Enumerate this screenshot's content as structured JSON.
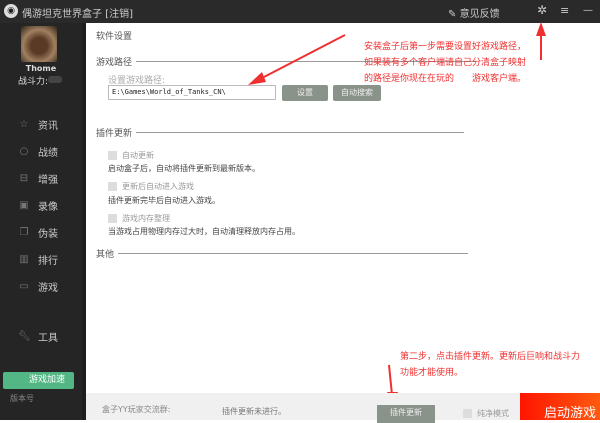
{
  "window": {
    "title": "偶游坦克世界盒子 [注销]",
    "feedback": "意见反馈"
  },
  "user": {
    "name": "Thome",
    "power_label": "战斗力:"
  },
  "sidebar": {
    "items": [
      {
        "label": "资讯",
        "icon": "star-icon"
      },
      {
        "label": "战绩",
        "icon": "search-icon"
      },
      {
        "label": "增强",
        "icon": "briefcase-icon"
      },
      {
        "label": "录像",
        "icon": "play-icon"
      },
      {
        "label": "伪装",
        "icon": "layers-icon"
      },
      {
        "label": "排行",
        "icon": "bar-chart-icon"
      },
      {
        "label": "游戏",
        "icon": "gamepad-icon"
      }
    ],
    "tools": "工具",
    "accelerate": "游戏加速",
    "version": "版本号"
  },
  "main": {
    "heading": "软件设置",
    "game_path": {
      "section": "游戏路径",
      "label": "设置游戏路径:",
      "value": "E:\\Games\\World_of_Tanks_CN\\",
      "set_button": "设置",
      "auto_button": "自动搜索"
    },
    "plugin": {
      "section": "插件更新",
      "options": [
        {
          "label": "自动更新",
          "desc": "启动盒子后，自动将插件更新到最新版本。",
          "checked": false
        },
        {
          "label": "更新后自动进入游戏",
          "desc": "插件更新完毕后自动进入游戏。",
          "checked": false
        },
        {
          "label": "游戏内存整理",
          "desc": "当游戏占用物理内存过大时，自动清理释放内存占用。",
          "checked": false
        }
      ]
    },
    "other": {
      "section": "其他"
    }
  },
  "annotations": {
    "note1_l1": "安装盒子后第一步需要设置好游戏路径，",
    "note1_l2": "如果装有多个客户端请自己分清盒子映射",
    "note1_l3": "的路径是你现在在玩的　　游戏客户端。",
    "note2_l1": "第二步，点击插件更新。更新后巨响和战斗力",
    "note2_l2": "功能才能使用。",
    "color": "#f03030"
  },
  "bottom": {
    "group": "盒子YY玩家交流群:",
    "status": "插件更新未进行。",
    "update_button": "插件更新",
    "pure_mode": "纯净模式",
    "start_button": "启动游戏"
  }
}
